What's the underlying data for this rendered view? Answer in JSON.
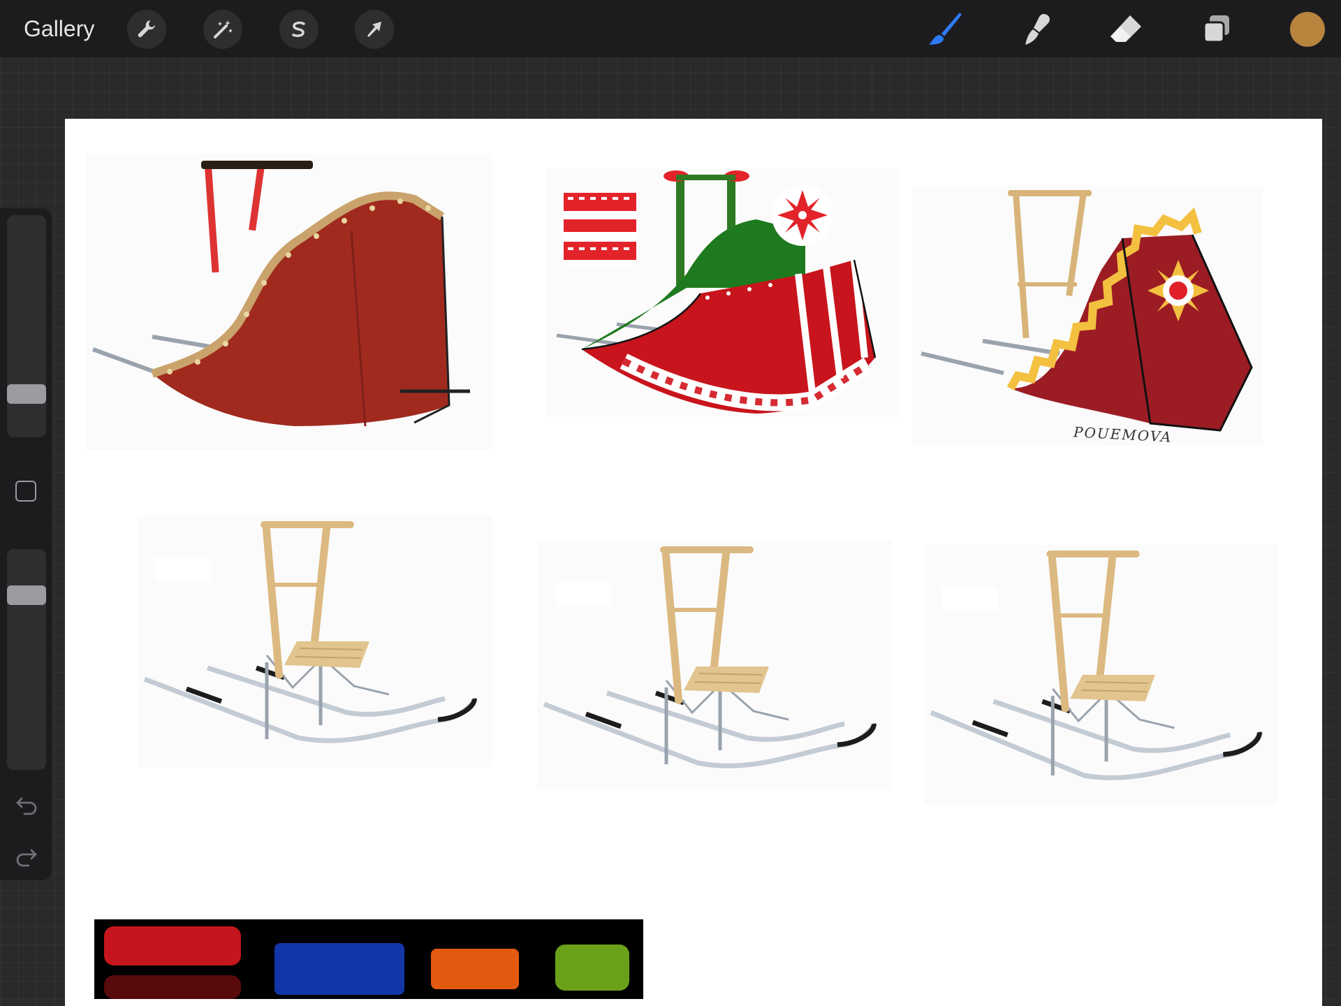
{
  "toolbar": {
    "gallery_label": "Gallery",
    "left_tools": [
      {
        "name": "actions",
        "icon": "wrench-icon"
      },
      {
        "name": "adjustments",
        "icon": "magic-wand-icon"
      },
      {
        "name": "selection",
        "icon": "selection-s-icon"
      },
      {
        "name": "transform",
        "icon": "arrow-cursor-icon"
      }
    ],
    "right_tools": [
      {
        "name": "brush",
        "icon": "brush-icon",
        "active": true
      },
      {
        "name": "smudge",
        "icon": "smudge-icon"
      },
      {
        "name": "eraser",
        "icon": "eraser-icon"
      },
      {
        "name": "layers",
        "icon": "layers-icon"
      }
    ],
    "current_color": "#b8843e",
    "active_tool_color": "#2d7bf6"
  },
  "sidebar": {
    "brush_size_level": 0.82,
    "opacity_level": 0.2,
    "buttons": [
      "modify-button",
      "undo-icon",
      "redo-icon"
    ]
  },
  "canvas": {
    "sketches": [
      {
        "id": "sled-gingerbread",
        "style": "red body with gold dotted trim and candy-cane handle"
      },
      {
        "id": "sled-nordic",
        "style": "red and green body with white star pattern and poinsettia"
      },
      {
        "id": "sled-star",
        "style": "dark red body with yellow zigzag trim and flower emblem"
      },
      {
        "id": "kicksled-1",
        "style": "plain wooden kicksled"
      },
      {
        "id": "kicksled-2",
        "style": "plain wooden kicksled"
      },
      {
        "id": "kicksled-3",
        "style": "plain wooden kicksled"
      }
    ],
    "signature": "POUEMOVA",
    "palette_colors": [
      "#c4161c",
      "#1236a8",
      "#e35a10",
      "#6aa119"
    ]
  }
}
